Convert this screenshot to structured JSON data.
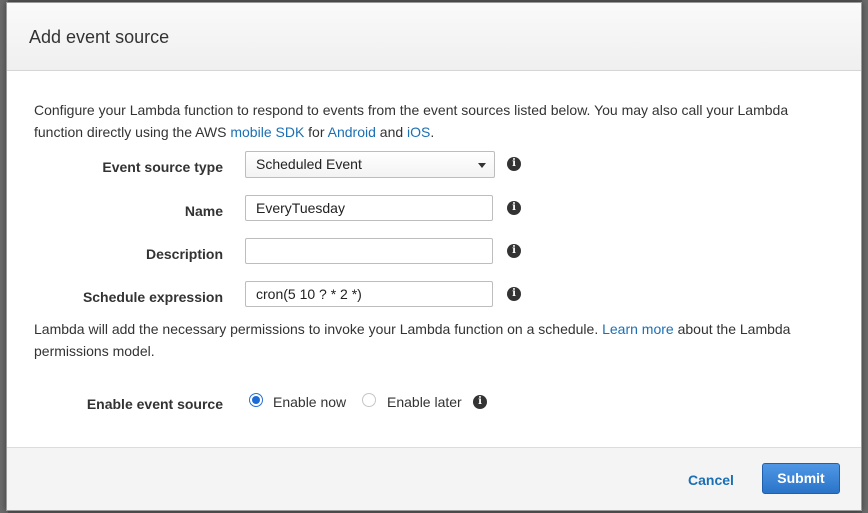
{
  "dialog": {
    "title": "Add event source"
  },
  "intro": {
    "text_before": "Configure your Lambda function to respond to events from the event sources listed below. You may also call your Lambda function directly using the AWS ",
    "link_mobile_sdk": "mobile SDK",
    "text_for": " for ",
    "link_android": "Android",
    "text_and": " and ",
    "link_ios": "iOS",
    "text_end": "."
  },
  "form": {
    "event_source_type": {
      "label": "Event source type",
      "selected": "Scheduled Event"
    },
    "name": {
      "label": "Name",
      "value": "EveryTuesday"
    },
    "description": {
      "label": "Description",
      "value": ""
    },
    "schedule_expression": {
      "label": "Schedule expression",
      "value": "cron(5 10 ? * 2 *)"
    }
  },
  "note": {
    "text_before": "Lambda will add the necessary permissions to invoke your Lambda function on a schedule. ",
    "link_learn_more": "Learn more",
    "text_after": " about the Lambda permissions model."
  },
  "enable": {
    "label": "Enable event source",
    "option_now": "Enable now",
    "option_later": "Enable later",
    "selected": "Enable now"
  },
  "footer": {
    "cancel_label": "Cancel",
    "submit_label": "Submit"
  },
  "icons": {
    "info": "info-icon",
    "caret": "chevron-down-icon"
  },
  "colors": {
    "link": "#1a6fb5",
    "primary_button": "#2a74c9",
    "radio_selected": "#1f6bd6"
  }
}
